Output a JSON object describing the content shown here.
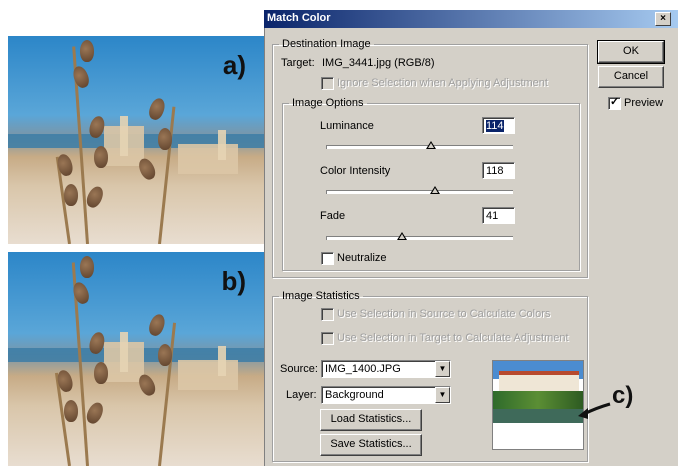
{
  "figure_labels": {
    "a": "a)",
    "b": "b)",
    "c": "c)"
  },
  "dialog": {
    "title": "Match Color",
    "close_glyph": "×",
    "buttons": {
      "ok": "OK",
      "cancel": "Cancel"
    },
    "preview": {
      "label": "Preview",
      "checked": true
    },
    "destination": {
      "legend": "Destination Image",
      "target_label": "Target:",
      "target_value": "IMG_3441.jpg (RGB/8)",
      "ignore_selection": "Ignore Selection when Applying Adjustment",
      "image_options": {
        "legend": "Image Options",
        "luminance": {
          "label": "Luminance",
          "value": "114",
          "slider": 0.57
        },
        "color_intensity": {
          "label": "Color Intensity",
          "value": "118",
          "slider": 0.59
        },
        "fade": {
          "label": "Fade",
          "value": "41",
          "slider": 0.41
        },
        "neutralize": "Neutralize"
      }
    },
    "statistics": {
      "legend": "Image Statistics",
      "use_source": "Use Selection in Source to Calculate Colors",
      "use_target": "Use Selection in Target to Calculate Adjustment",
      "source_label": "Source:",
      "source_value": "IMG_1400.JPG",
      "layer_label": "Layer:",
      "layer_value": "Background",
      "load_button": "Load Statistics...",
      "save_button": "Save Statistics..."
    }
  },
  "colors": {
    "titlebar": "#0a246a",
    "dialog_bg": "#d4d0c8",
    "selection": "#0a246a"
  }
}
